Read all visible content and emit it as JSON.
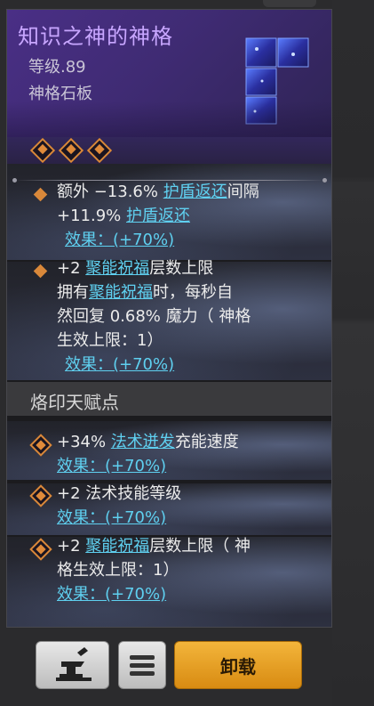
{
  "item": {
    "title": "知识之神的神格",
    "level": "等级.89",
    "type": "神格石板"
  },
  "affixes": [
    {
      "line1_pre": "额外 −13.6% ",
      "line1_link": "护盾返还",
      "line1_post": "间隔",
      "line2_pre": "+11.9% ",
      "line2_link": "护盾返还",
      "effect": "效果：(+70%)"
    },
    {
      "line1_pre": "+2 ",
      "line1_link": "聚能祝福",
      "line1_post": "层数上限",
      "line2_pre": "拥有",
      "line2_link": "聚能祝福",
      "line2_post": "时，每秒自",
      "line3": "然回复 0.68% 魔力（ 神格",
      "line4": "生效上限：1）",
      "effect": "效果：(+70%)"
    }
  ],
  "talents": {
    "title": "烙印天赋点",
    "items": [
      {
        "pre": "+34% ",
        "link": "法术迸发",
        "post": "充能速度",
        "effect": "效果：(+70%)"
      },
      {
        "pre": "+2 法术技能等级",
        "effect": "效果：(+70%)"
      },
      {
        "pre": "+2 ",
        "link": "聚能祝福",
        "post": "层数上限（ 神",
        "line2": "格生效上限：1）",
        "effect": "效果：(+70%)"
      }
    ]
  },
  "buttons": {
    "forge_icon": "anvil-icon",
    "menu_icon": "menu-icon",
    "unload_label": "卸载"
  },
  "colors": {
    "title": "#c8a6ff",
    "link": "#5fd0f0",
    "accent": "#d9883a",
    "unload_button": "#e8a125"
  }
}
